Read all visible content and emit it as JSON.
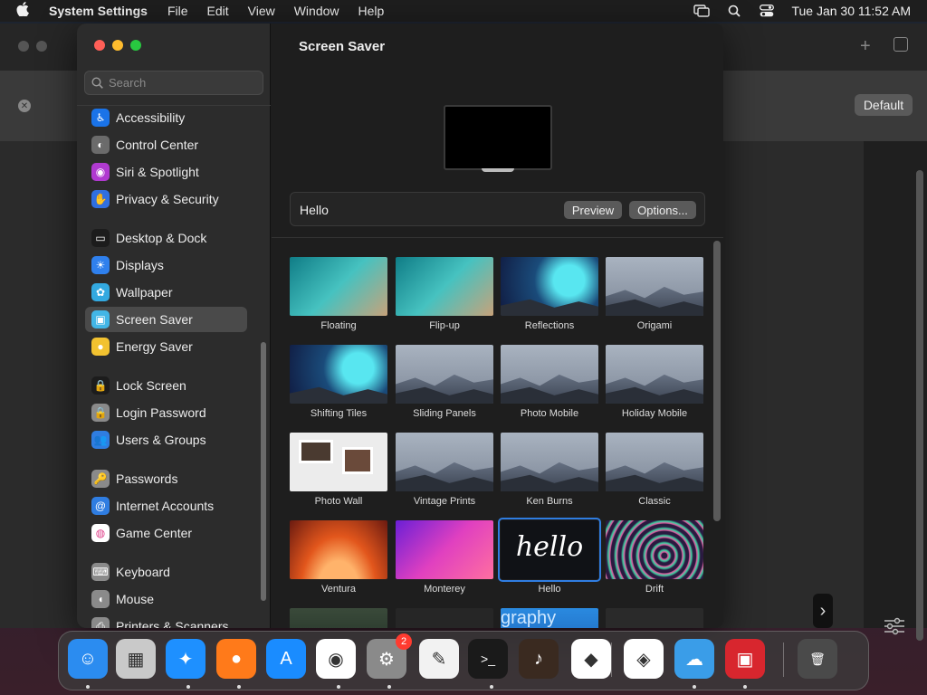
{
  "menubar": {
    "app_name": "System Settings",
    "menus": [
      "File",
      "Edit",
      "View",
      "Window",
      "Help"
    ],
    "datetime": "Tue Jan 30  11:52 AM"
  },
  "background_window": {
    "default_button": "Default"
  },
  "sidebar": {
    "search_placeholder": "Search",
    "items": [
      {
        "label": "Accessibility",
        "icon": "accessibility-icon",
        "color": "#1a73e8"
      },
      {
        "label": "Control Center",
        "icon": "control-center-icon",
        "color": "#6b6b6b"
      },
      {
        "label": "Siri & Spotlight",
        "icon": "siri-icon",
        "color": "#b03ad0"
      },
      {
        "label": "Privacy & Security",
        "icon": "hand-icon",
        "color": "#2f6fe0"
      },
      {
        "label": "Desktop & Dock",
        "icon": "dock-icon",
        "color": "#1c1c1c"
      },
      {
        "label": "Displays",
        "icon": "sun-icon",
        "color": "#2f80ed"
      },
      {
        "label": "Wallpaper",
        "icon": "flower-icon",
        "color": "#33a9e0"
      },
      {
        "label": "Screen Saver",
        "icon": "screen-saver-icon",
        "color": "#42b6e6"
      },
      {
        "label": "Energy Saver",
        "icon": "bulb-icon",
        "color": "#f2c230"
      },
      {
        "label": "Lock Screen",
        "icon": "lock-icon",
        "color": "#1c1c1c"
      },
      {
        "label": "Login Password",
        "icon": "lock-icon",
        "color": "#8a8a8a"
      },
      {
        "label": "Users & Groups",
        "icon": "users-icon",
        "color": "#2f7de1"
      },
      {
        "label": "Passwords",
        "icon": "key-icon",
        "color": "#8a8a8a"
      },
      {
        "label": "Internet Accounts",
        "icon": "at-icon",
        "color": "#2f7de1"
      },
      {
        "label": "Game Center",
        "icon": "game-center-icon",
        "color": "#ffffff"
      },
      {
        "label": "Keyboard",
        "icon": "keyboard-icon",
        "color": "#8a8a8a"
      },
      {
        "label": "Mouse",
        "icon": "mouse-icon",
        "color": "#8a8a8a"
      },
      {
        "label": "Printers & Scanners",
        "icon": "printer-icon",
        "color": "#8a8a8a"
      }
    ],
    "selected": "Screen Saver"
  },
  "main": {
    "title": "Screen Saver",
    "current_saver": "Hello",
    "preview_button": "Preview",
    "options_button": "Options...",
    "savers": [
      {
        "label": "Floating",
        "style": "ocean"
      },
      {
        "label": "Flip-up",
        "style": "ocean"
      },
      {
        "label": "Reflections",
        "style": "coral"
      },
      {
        "label": "Origami",
        "style": "mountain"
      },
      {
        "label": "Shifting Tiles",
        "style": "coral"
      },
      {
        "label": "Sliding Panels",
        "style": "mountain"
      },
      {
        "label": "Photo Mobile",
        "style": "mountain"
      },
      {
        "label": "Holiday Mobile",
        "style": "mountain"
      },
      {
        "label": "Photo Wall",
        "style": "wall"
      },
      {
        "label": "Vintage Prints",
        "style": "mountain"
      },
      {
        "label": "Ken Burns",
        "style": "mountain"
      },
      {
        "label": "Classic",
        "style": "mountain"
      },
      {
        "label": "Ventura",
        "style": "ventura"
      },
      {
        "label": "Monterey",
        "style": "monterey"
      },
      {
        "label": "Hello",
        "style": "hello"
      },
      {
        "label": "Drift",
        "style": "drift"
      }
    ],
    "hello_text": "hello",
    "partial_row_text": "graphy"
  },
  "dock": {
    "apps": [
      {
        "name": "finder-icon",
        "color": "#2b8cf0",
        "glyph": "☺"
      },
      {
        "name": "launchpad-icon",
        "color": "#c9c9c9",
        "glyph": "▦"
      },
      {
        "name": "safari-icon",
        "color": "#1e90ff",
        "glyph": "✦"
      },
      {
        "name": "firefox-icon",
        "color": "#ff7a1a",
        "glyph": "●"
      },
      {
        "name": "app-store-icon",
        "color": "#1a8cff",
        "glyph": "A"
      },
      {
        "name": "chrome-icon",
        "color": "#ffffff",
        "glyph": "◉"
      },
      {
        "name": "system-settings-icon",
        "color": "#8a8a8a",
        "glyph": "⚙",
        "badge": "2"
      },
      {
        "name": "textedit-icon",
        "color": "#f2f2f2",
        "glyph": "✎"
      },
      {
        "name": "terminal-icon",
        "color": "#1a1a1a",
        "glyph": ">_"
      },
      {
        "name": "garageband-icon",
        "color": "#3a2a20",
        "glyph": "♪"
      },
      {
        "name": "vscode-icon",
        "color": "#ffffff",
        "glyph": "◆"
      },
      {
        "name": "visual-studio-icon",
        "color": "#ffffff",
        "glyph": "◈"
      },
      {
        "name": "weather-icon",
        "color": "#3a9de8",
        "glyph": "☁"
      },
      {
        "name": "photo-booth-icon",
        "color": "#d8262e",
        "glyph": "▣"
      },
      {
        "name": "trash-icon",
        "color": "#4a4a4a",
        "glyph": "🗑"
      }
    ]
  }
}
